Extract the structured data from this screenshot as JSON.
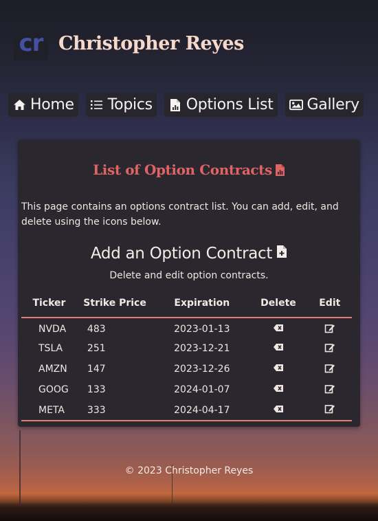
{
  "header": {
    "logo_text": "cr",
    "site_title": "Christopher Reyes"
  },
  "nav": [
    {
      "label": "Home",
      "icon": "home-icon"
    },
    {
      "label": "Topics",
      "icon": "list-icon"
    },
    {
      "label": "Options List",
      "icon": "file-chart-icon"
    },
    {
      "label": "Gallery",
      "icon": "image-icon"
    }
  ],
  "card": {
    "title": "List of Option Contracts",
    "intro": "This page contains an options contract list. You can add, edit, and delete using the icons below.",
    "add_title": "Add an Option Contract",
    "caption": "Delete and edit option contracts."
  },
  "table": {
    "headers": [
      "Ticker",
      "Strike Price",
      "Expiration",
      "Delete",
      "Edit"
    ],
    "rows": [
      {
        "ticker": "NVDA",
        "strike": "483",
        "expiration": "2023-01-13"
      },
      {
        "ticker": "TSLA",
        "strike": "251",
        "expiration": "2023-12-21"
      },
      {
        "ticker": "AMZN",
        "strike": "147",
        "expiration": "2023-12-26"
      },
      {
        "ticker": "GOOG",
        "strike": "133",
        "expiration": "2024-01-07"
      },
      {
        "ticker": "META",
        "strike": "333",
        "expiration": "2024-04-17"
      }
    ]
  },
  "footer": {
    "copyright": "© 2023 Christopher Reyes"
  },
  "colors": {
    "accent": "#e06464",
    "divider": "#e37f75",
    "logo": "#4451a3",
    "title": "#f7d9cb"
  }
}
